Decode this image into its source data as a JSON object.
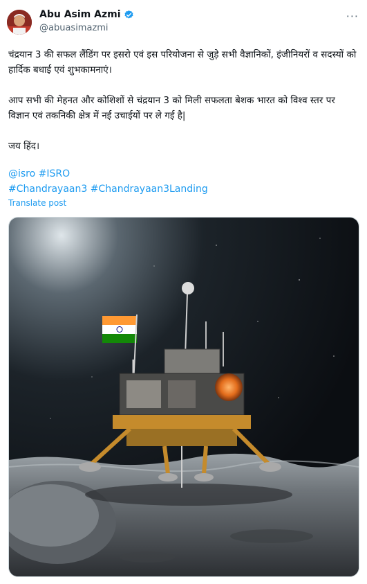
{
  "author": {
    "display_name": "Abu Asim Azmi",
    "handle": "@abuasimazmi",
    "verified_icon": "verified-badge-icon",
    "avatar_icon": "profile-avatar"
  },
  "more_icon": "more-horizontal-icon",
  "more_label": "···",
  "post": {
    "paragraph_1": "चंद्रयान 3 की सफल लैंडिंग पर इसरो एवं इस परियोजना से जुड़े सभी वैज्ञानिकों, इंजीनियरों व सदस्यों को हार्दिक बधाई एवं शुभकामनाएं।",
    "paragraph_2": "आप सभी की मेहनत और कोशिशों से चंद्रयान 3 को मिली सफलता बेशक भारत को विश्व स्तर पर विज्ञान एवं तकनिकी क्षेत्र में नई उचाईयों पर ले गई है|",
    "paragraph_3": "जय हिंद।",
    "mention_1": "@isro",
    "hashtag_1": "#ISRO",
    "hashtag_2": "#Chandrayaan3",
    "hashtag_3": "#Chandrayaan3Landing"
  },
  "translate_label": "Translate post",
  "colors": {
    "link": "#1d9bf0",
    "text": "#0f1419",
    "secondary": "#536471"
  },
  "media": {
    "icon": "moon-lander-image"
  }
}
